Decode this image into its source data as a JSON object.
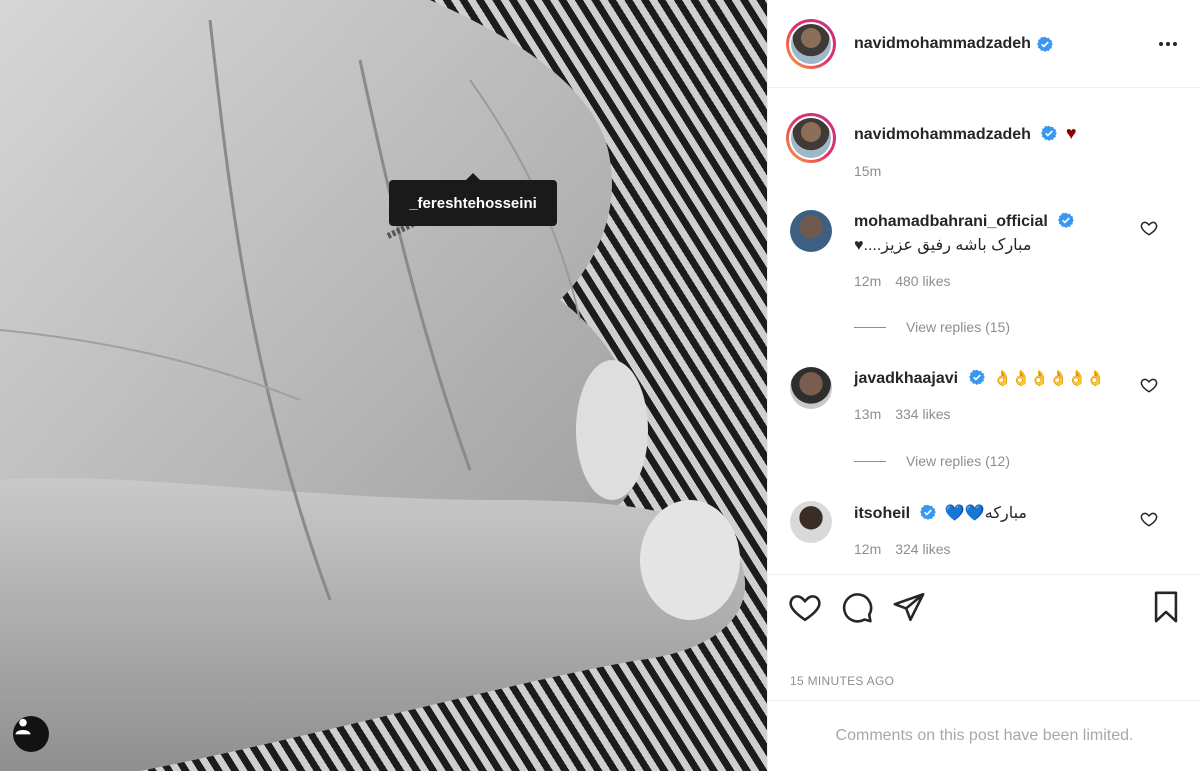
{
  "photo": {
    "tag_label": "_fereshtehosseini",
    "tag_button_icon": "user-icon"
  },
  "header": {
    "username": "navidmohammadzadeh",
    "verified_icon": "verified-badge-icon",
    "more_icon": "more-options-icon"
  },
  "caption": {
    "username": "navidmohammadzadeh",
    "text": "♥",
    "time": "15m"
  },
  "comments": [
    {
      "username": "mohamadbahrani_official",
      "text": "مبارک باشه رفیق عزیز....♥",
      "time": "12m",
      "likes": "480 likes",
      "replies": "View replies (15)"
    },
    {
      "username": "javadkhaajavi",
      "text": "👌👌👌👌👌👌",
      "time": "13m",
      "likes": "334 likes",
      "replies": "View replies (12)"
    },
    {
      "username": "itsoheil",
      "text": "مبارکه💙💙",
      "time": "12m",
      "likes": "324 likes"
    }
  ],
  "actions": {
    "like_icon": "heart-icon",
    "comment_icon": "comment-icon",
    "share_icon": "send-icon",
    "save_icon": "bookmark-icon"
  },
  "timestamp": "15 MINUTES AGO",
  "limited_notice": "Comments on this post have been limited.",
  "colors": {
    "verified": "#3897f0",
    "heart_red": "#8b0000",
    "muted": "#8e8e8e",
    "divider": "#efefef"
  }
}
